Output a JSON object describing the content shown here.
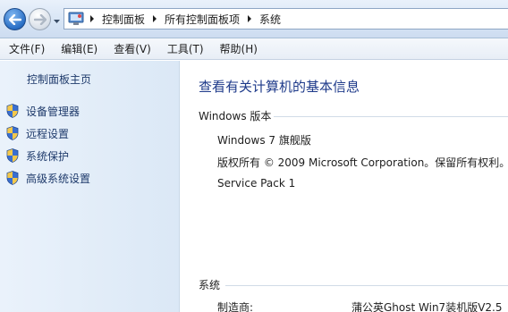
{
  "navigation": {
    "breadcrumbs": [
      "控制面板",
      "所有控制面板项",
      "系统"
    ]
  },
  "menubar": {
    "items": [
      "文件(F)",
      "编辑(E)",
      "查看(V)",
      "工具(T)",
      "帮助(H)"
    ]
  },
  "sidebar": {
    "home_link": "控制面板主页",
    "tasks": [
      {
        "label": "设备管理器",
        "icon": "shield-icon"
      },
      {
        "label": "远程设置",
        "icon": "shield-icon"
      },
      {
        "label": "系统保护",
        "icon": "shield-icon"
      },
      {
        "label": "高级系统设置",
        "icon": "shield-icon"
      }
    ]
  },
  "main": {
    "title": "查看有关计算机的基本信息",
    "edition_section": {
      "heading": "Windows 版本",
      "edition": "Windows 7 旗舰版",
      "copyright": "版权所有 © 2009 Microsoft Corporation。保留所有权利。",
      "service_pack": "Service Pack 1"
    },
    "system_section": {
      "heading": "系统",
      "manufacturer_label": "制造商:",
      "manufacturer_value": "蒲公英Ghost Win7装机版V2.5"
    }
  },
  "colors": {
    "title_blue": "#1e3a8a",
    "link_blue": "#1e3a6b",
    "pane_bg": "#dbe8f6"
  }
}
